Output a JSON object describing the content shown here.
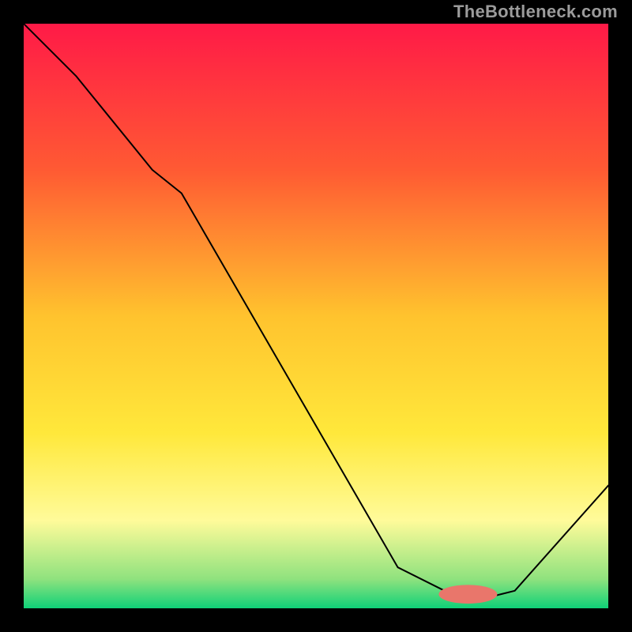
{
  "attribution": "TheBottleneck.com",
  "chart_data": {
    "type": "line",
    "title": "",
    "xlabel": "",
    "ylabel": "",
    "xlim": [
      0,
      100
    ],
    "ylim": [
      0,
      100
    ],
    "background": {
      "type": "vertical-gradient",
      "stops": [
        {
          "pos": 0.0,
          "color": "#ff1a47"
        },
        {
          "pos": 0.25,
          "color": "#ff5a33"
        },
        {
          "pos": 0.5,
          "color": "#ffc32e"
        },
        {
          "pos": 0.7,
          "color": "#ffe83b"
        },
        {
          "pos": 0.85,
          "color": "#fffb9a"
        },
        {
          "pos": 0.95,
          "color": "#8fe27e"
        },
        {
          "pos": 1.0,
          "color": "#0fd178"
        }
      ]
    },
    "curve": {
      "color": "#000000",
      "width": 2,
      "x": [
        0,
        9,
        22,
        27,
        64,
        72,
        80,
        84,
        100
      ],
      "y": [
        100,
        91,
        75,
        71,
        7,
        3,
        2,
        3,
        21
      ]
    },
    "marker": {
      "cx": 76,
      "cy": 2.4,
      "rx": 5,
      "ry": 1.6,
      "color": "#e9766b"
    }
  }
}
